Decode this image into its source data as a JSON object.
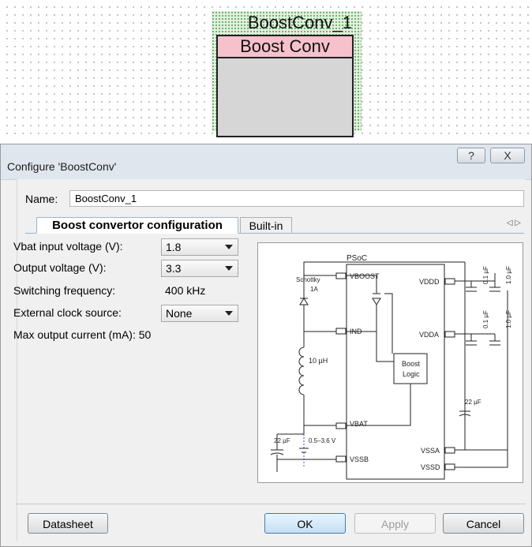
{
  "canvas": {
    "component_instance_name": "BoostConv_1",
    "component_title": "Boost Conv"
  },
  "dialog": {
    "title": "Configure 'BoostConv'",
    "help_label": "?",
    "close_label": "X",
    "name_label": "Name:",
    "name_value": "BoostConv_1",
    "tabs": [
      {
        "label": "Boost convertor configuration",
        "active": true
      },
      {
        "label": "Built-in",
        "active": false
      }
    ],
    "tab_scroll_label": "◁ ▷",
    "fields": {
      "vbat_label": "Vbat input voltage (V):",
      "vbat_value": "1.8",
      "output_label": "Output voltage (V):",
      "output_value": "3.3",
      "switching_label": "Switching frequency:",
      "switching_value": "400 kHz",
      "ext_clock_label": "External clock source:",
      "ext_clock_value": "None",
      "max_current_label": "Max output current (mA):",
      "max_current_value": "50"
    },
    "diagram": {
      "chip_label": "PSoC",
      "pins": {
        "vboost": "VBOOST",
        "ind": "IND",
        "vbat": "VBAT",
        "vssb": "VSSB",
        "vddd": "VDDD",
        "vdda": "VDDA",
        "vssa": "VSSA",
        "vssd": "VSSD"
      },
      "logic_line1": "Boost",
      "logic_line2": "Logic",
      "schottky_line1": "Schottky",
      "schottky_line2": "1A",
      "inductor": "10 µH",
      "cap_bat": "22 µF",
      "battery_range": "0.5–3.6 V",
      "cap_out": "22 µF",
      "cap_vddd_a": "0.1 µF",
      "cap_vddd_b": "1.0 µF",
      "cap_vdda_a": "0.1 µF",
      "cap_vdda_b": "1.0 µF"
    },
    "buttons": {
      "datasheet": "Datasheet",
      "ok": "OK",
      "apply": "Apply",
      "cancel": "Cancel"
    }
  }
}
